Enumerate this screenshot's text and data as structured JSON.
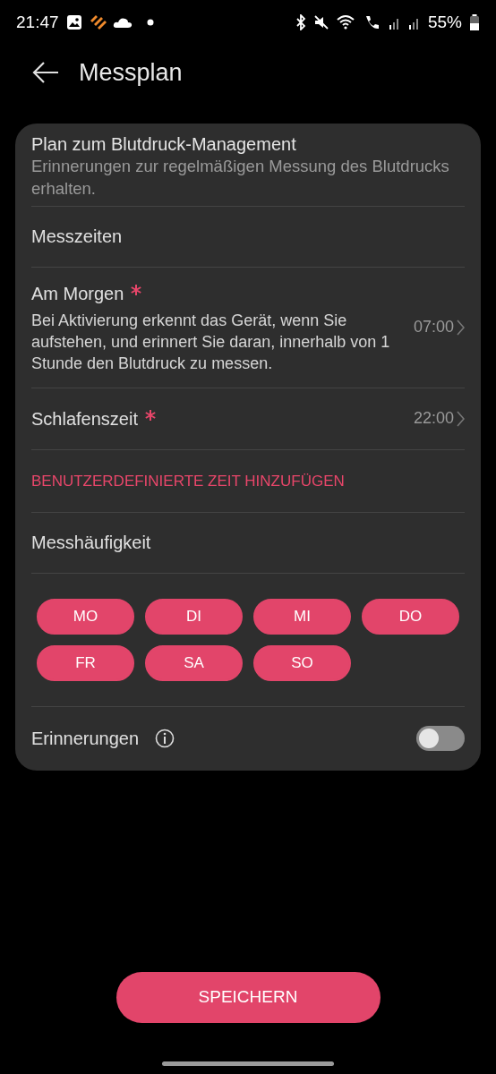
{
  "status_bar": {
    "time": "21:47",
    "battery": "55%"
  },
  "header": {
    "title": "Messplan"
  },
  "card": {
    "title": "Plan zum Blutdruck-Management",
    "subtitle": "Erinnerungen zur regelmäßigen Messung des Blutdrucks erhalten.",
    "sections": [
      {
        "kind": "heading",
        "label": "Messzeiten"
      },
      {
        "kind": "time",
        "label": "Am Morgen",
        "required": true,
        "description": "Bei Aktivierung erkennt das Gerät, wenn Sie aufstehen, und erinnert Sie daran, innerhalb von 1 Stunde den Blutdruck zu messen.",
        "value": "07:00"
      },
      {
        "kind": "time",
        "label": "Schlafenszeit",
        "required": true,
        "value": "22:00"
      },
      {
        "kind": "link",
        "label": "BENUTZERDEFINIERTE ZEIT HINZUFÜGEN"
      },
      {
        "kind": "heading",
        "label": "Messhäufigkeit"
      }
    ],
    "days": [
      {
        "label": "MO",
        "selected": true
      },
      {
        "label": "DI",
        "selected": true
      },
      {
        "label": "MI",
        "selected": true
      },
      {
        "label": "DO",
        "selected": true
      },
      {
        "label": "FR",
        "selected": true
      },
      {
        "label": "SA",
        "selected": true
      },
      {
        "label": "SO",
        "selected": true
      }
    ],
    "reminders": {
      "label": "Erinnerungen",
      "on": false
    }
  },
  "save_button": {
    "label": "SPEICHERN"
  }
}
